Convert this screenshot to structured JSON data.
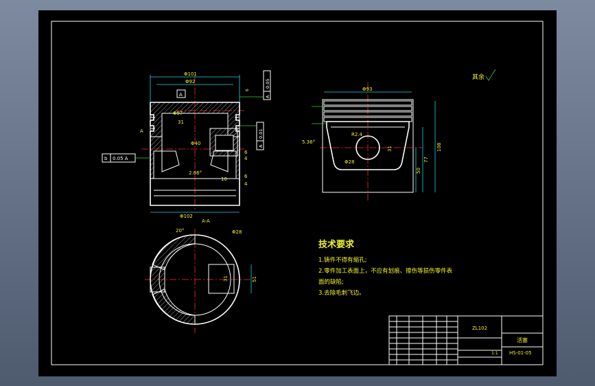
{
  "views": {
    "front": {
      "dims": {
        "d101": "Φ101",
        "d92": "Φ92",
        "d57": "Φ57",
        "d40": "Φ40",
        "d102": "Φ102",
        "dim31": "31",
        "dim6": "6",
        "dim4": "4",
        "dim10": "10",
        "dim25": "2.86°",
        "d6g": "6",
        "d4g": "4"
      },
      "datum_a": "A",
      "datum_b": "b",
      "tol_left_sym": "b",
      "tol_left_val": "0.05  A",
      "tol_top_sym": "0.05",
      "tol_top_val": "A",
      "tol_right_val": "0.01",
      "tol_right_ref": "A",
      "section_label_a": "A"
    },
    "side": {
      "d93": "Φ93",
      "r": "R2.4",
      "angle": "5.36°",
      "d28": "Φ28",
      "d31": "31",
      "d77": "77",
      "d50": "50",
      "d108": "108"
    },
    "section": {
      "title": "A-A",
      "d28": "Φ28",
      "angle": "20°",
      "d31": "31",
      "d51": "51"
    }
  },
  "roughness": {
    "label": "其余"
  },
  "notes": {
    "title": "技术要求",
    "lines": [
      "1.铸件不得有缩孔;",
      "2.零件加工表面上，不应有划痕、擦伤等损伤零件表",
      "面的缺陷;",
      "3.去除毛刺飞边。"
    ]
  },
  "title_block": {
    "material": "ZL102",
    "name": "活塞",
    "drawing_no": "HS-01-05",
    "scale": "1:1"
  },
  "colors": {
    "background": "#000000",
    "outline": "#ffffff",
    "centerline": "#ff2a2a",
    "dimension": "#19d9e6",
    "annotation": "#33d633",
    "text": "#f2f22e"
  }
}
